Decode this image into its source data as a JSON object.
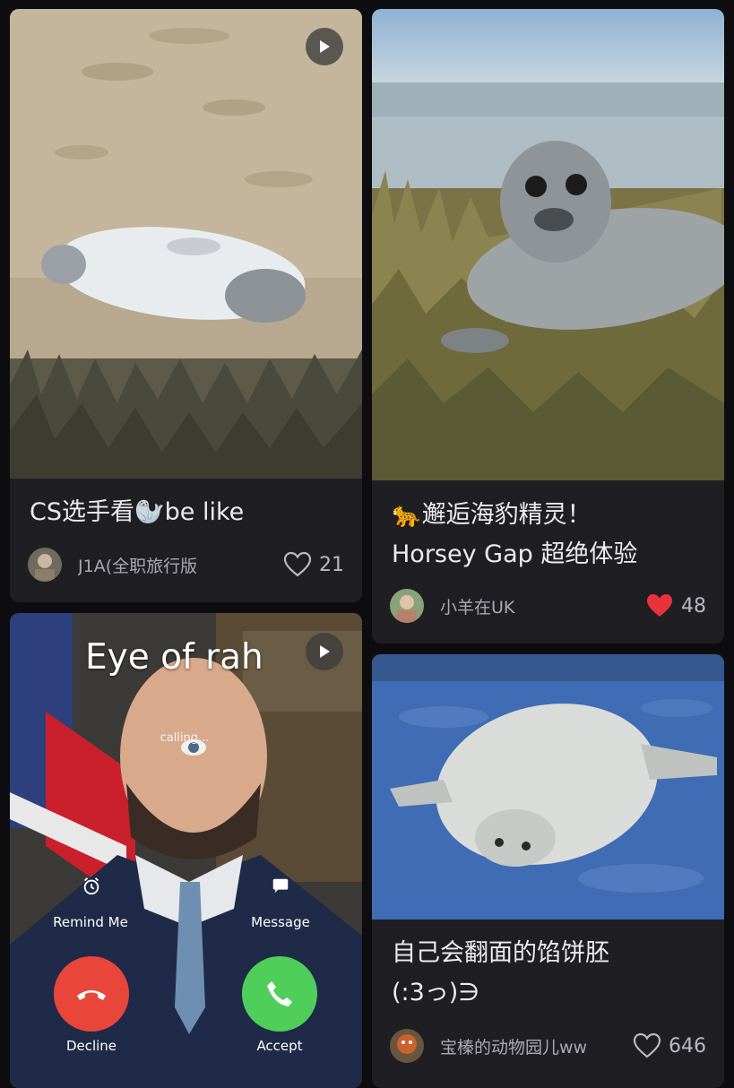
{
  "feed": {
    "cards": [
      {
        "title": "CS选手看🦭be like",
        "author": "J1A(全职旅行版",
        "likes": "21",
        "liked": false,
        "video": true
      },
      {
        "title_line1": "🐆邂逅海豹精灵！",
        "title_line2": "Horsey Gap 超绝体验",
        "author": "小羊在UK",
        "likes": "48",
        "liked": true,
        "video": false
      },
      {
        "overlay_caption": "Eye of rah",
        "overlay_status": "calling...",
        "remind_label": "Remind Me",
        "message_label": "Message",
        "decline_label": "Decline",
        "accept_label": "Accept",
        "video": true
      },
      {
        "title_line1": "自己会翻面的馅饼胚",
        "title_line2": "(:3っ)∋",
        "author": "宝榛的动物园儿ww",
        "likes": "646",
        "liked": false,
        "video": false
      }
    ]
  },
  "colors": {
    "background": "#0d0d10",
    "card": "#1f1f23",
    "liked_heart": "#e8323c",
    "decline": "#e8463b",
    "accept": "#4fcf5a"
  },
  "icons": {
    "play": "play-icon",
    "heart": "heart-icon",
    "alarm": "alarm-icon",
    "message": "message-icon",
    "phone_decline": "phone-decline-icon",
    "phone_accept": "phone-accept-icon"
  }
}
